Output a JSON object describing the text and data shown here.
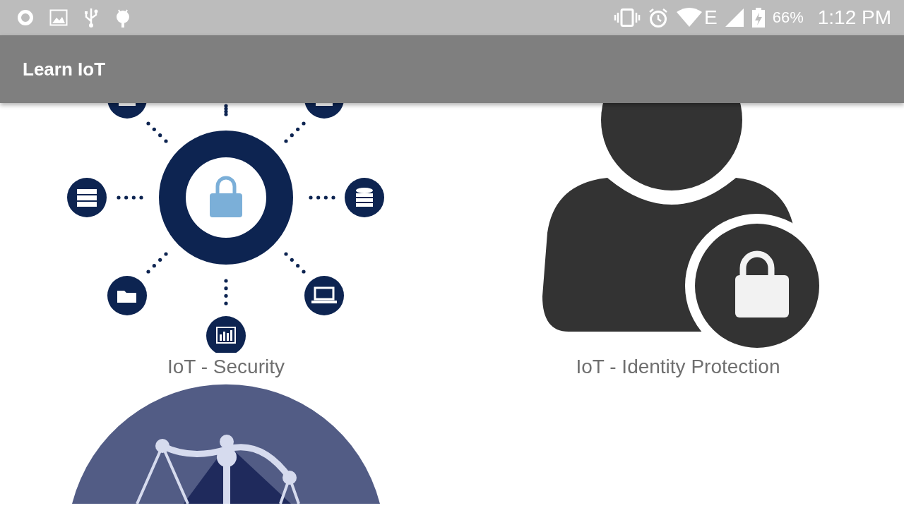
{
  "status_bar": {
    "network_type": "E",
    "battery": "66%",
    "time": "1:12 PM"
  },
  "app_bar": {
    "title": "Learn IoT"
  },
  "tiles": [
    {
      "kind": "security",
      "label": "IoT - Security"
    },
    {
      "kind": "identity",
      "label": "IoT - Identity Protection"
    },
    {
      "kind": "scales"
    }
  ]
}
